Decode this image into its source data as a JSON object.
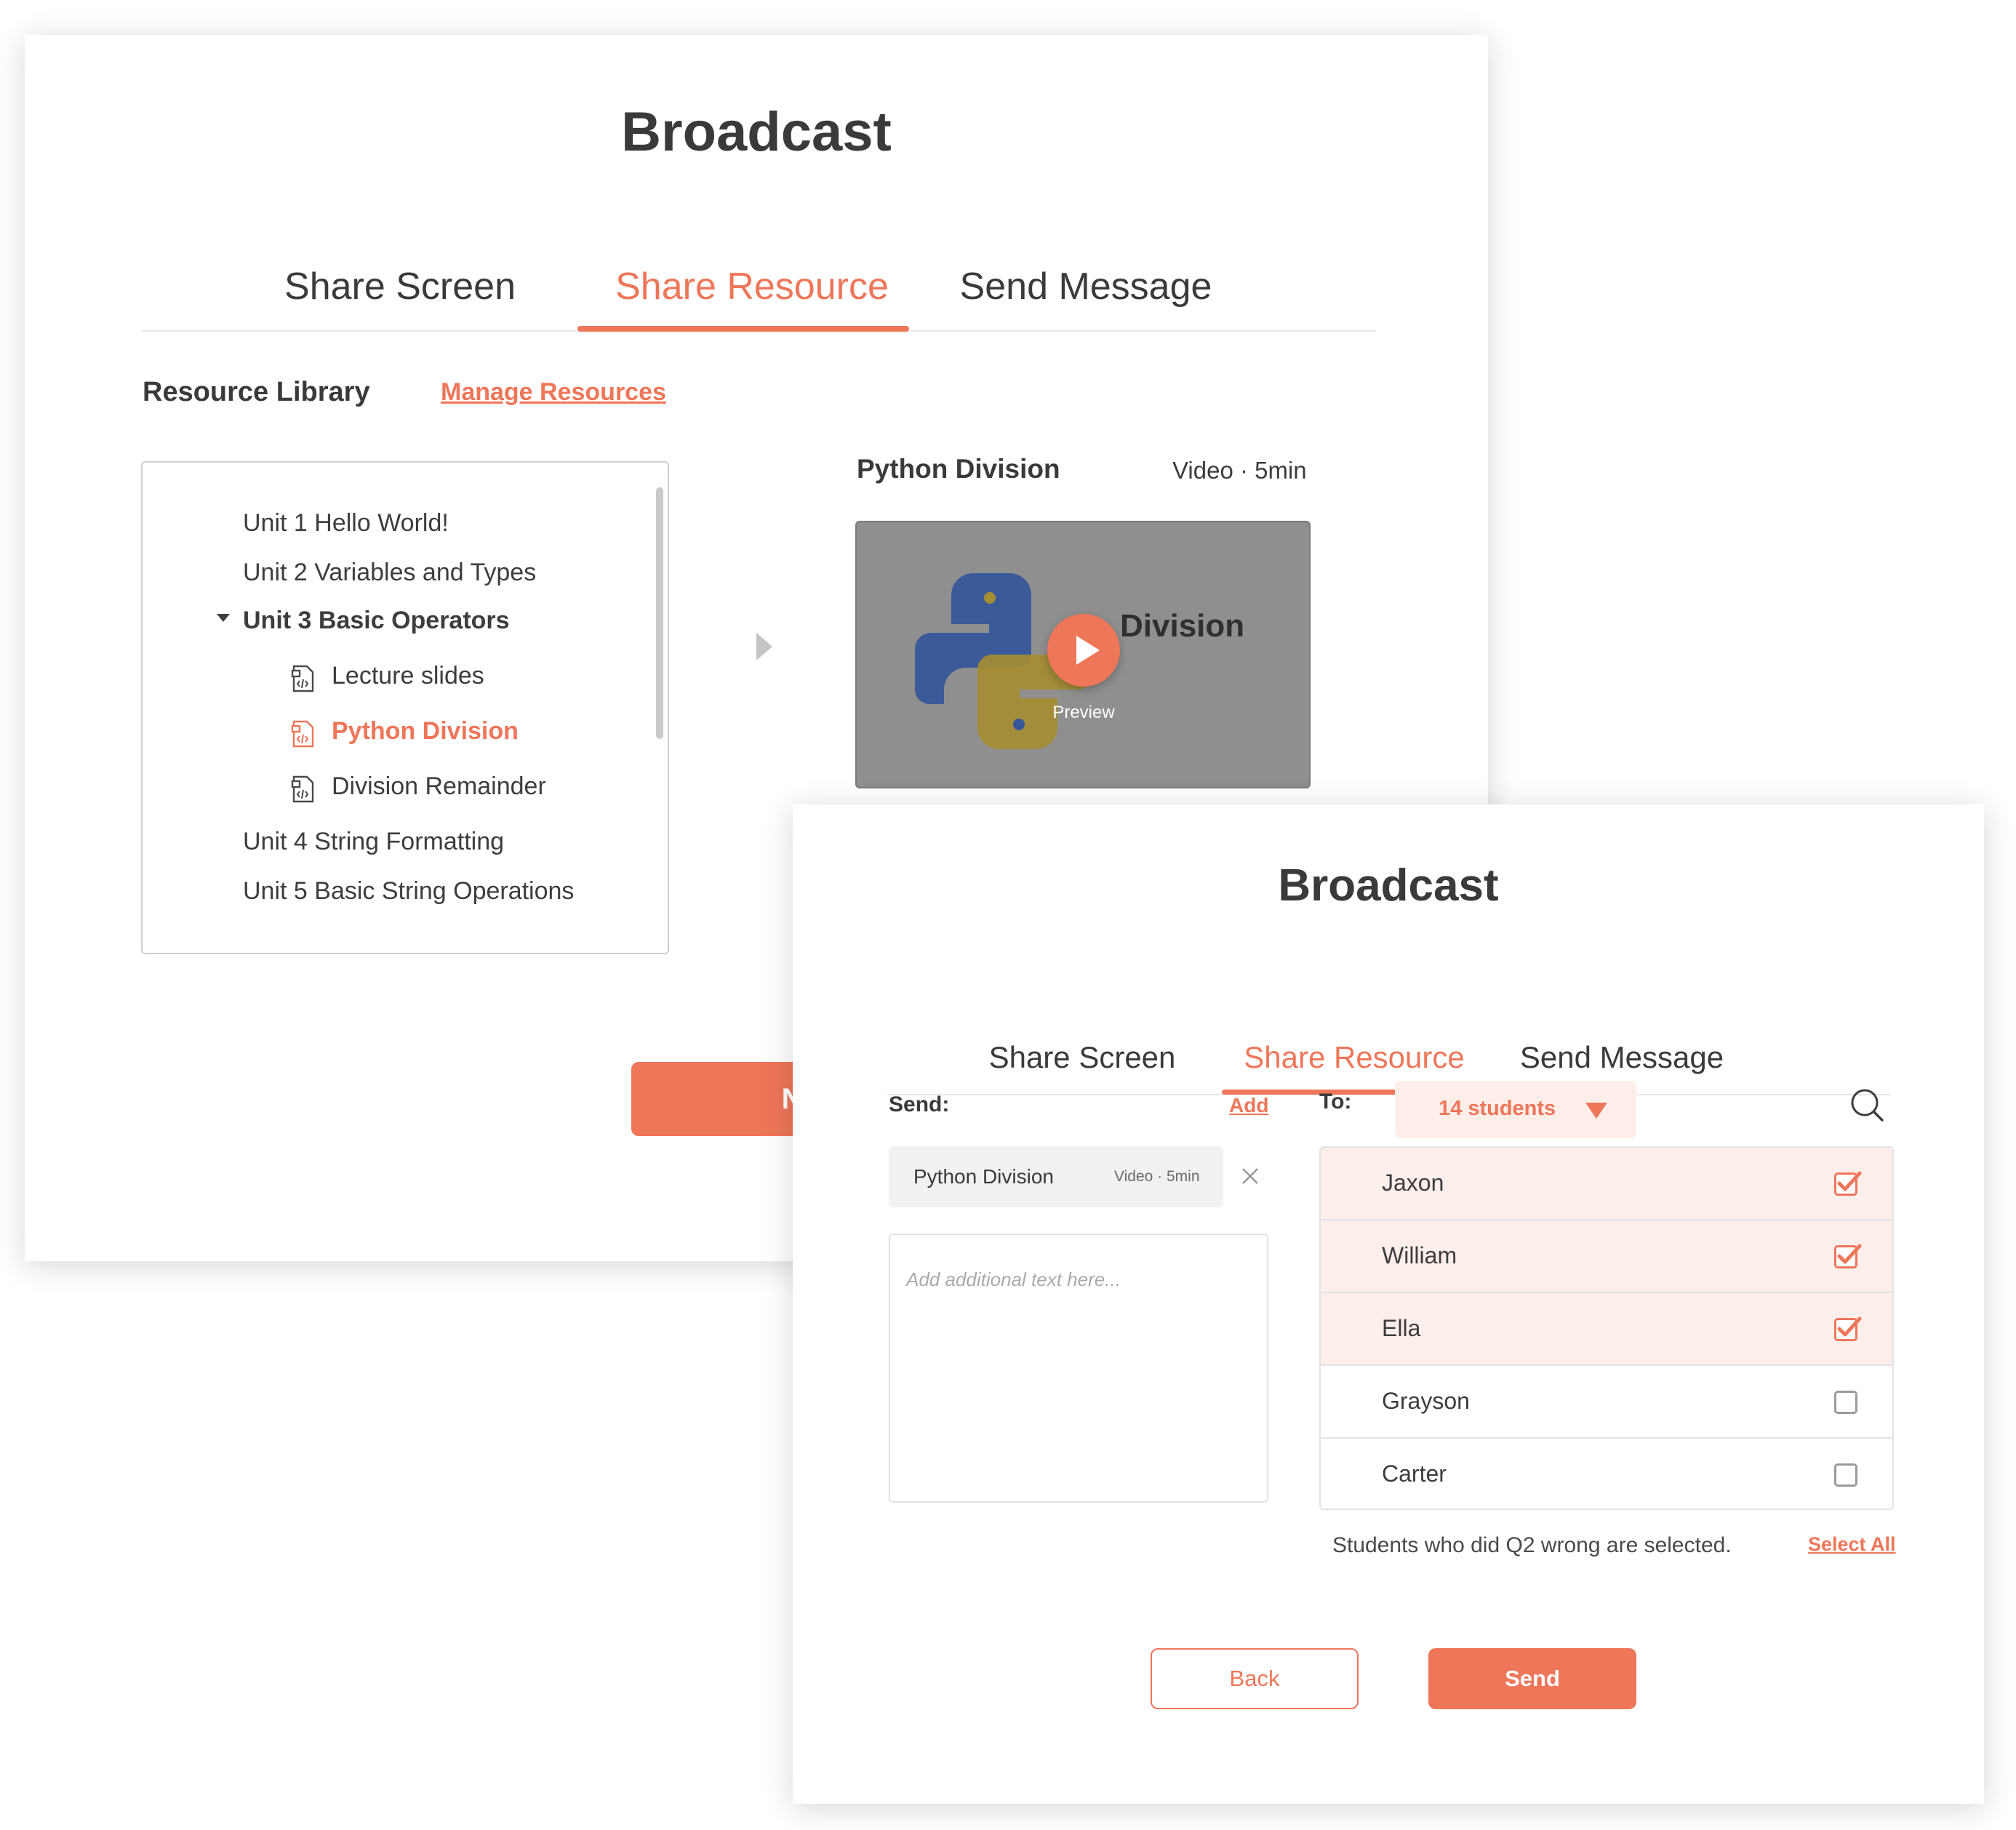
{
  "panel_back": {
    "title": "Broadcast",
    "tabs": [
      "Share Screen",
      "Share Resource",
      "Send Message"
    ],
    "active_tab": "Share Resource",
    "library_label": "Resource Library",
    "manage_link": "Manage Resources",
    "tree": {
      "units": [
        "Unit 1 Hello World!",
        "Unit 2 Variables and Types",
        "Unit 3 Basic Operators",
        "Unit 4 String Formatting",
        "Unit 5 Basic String Operations"
      ],
      "expanded_unit": "Unit 3 Basic Operators",
      "children": [
        "Lecture slides",
        "Python Division",
        "Division Remainder"
      ],
      "selected": "Python Division"
    },
    "preview": {
      "title": "Python Division",
      "meta": "Video · 5min",
      "thumb_text": "Division",
      "play_label": "Preview"
    },
    "next_button": "Next"
  },
  "panel_front": {
    "title": "Broadcast",
    "tabs": [
      "Share Screen",
      "Share Resource",
      "Send Message"
    ],
    "active_tab": "Share Resource",
    "send_label": "Send:",
    "add_link": "Add",
    "chip": {
      "title": "Python Division",
      "meta": "Video · 5min"
    },
    "textarea_placeholder": "Add additional text here...",
    "to_label": "To:",
    "dropdown_value": "14 students",
    "students": [
      {
        "name": "Jaxon",
        "checked": true
      },
      {
        "name": "William",
        "checked": true
      },
      {
        "name": "Ella",
        "checked": true
      },
      {
        "name": "Grayson",
        "checked": false
      },
      {
        "name": "Carter",
        "checked": false
      }
    ],
    "hint": "Students who did Q2 wrong are selected.",
    "select_all": "Select All",
    "back_button": "Back",
    "send_button": "Send"
  },
  "colors": {
    "accent": "#ee7659",
    "selected_row": "#fbeeeb",
    "video_bg": "#8f8f8f"
  },
  "icons": [
    "file-code-icon",
    "chevron-down-icon",
    "chevron-right-icon",
    "play-icon",
    "python-logo",
    "close-icon",
    "triangle-down-icon",
    "search-icon",
    "checkbox-checked-icon",
    "checkbox-empty-icon"
  ]
}
